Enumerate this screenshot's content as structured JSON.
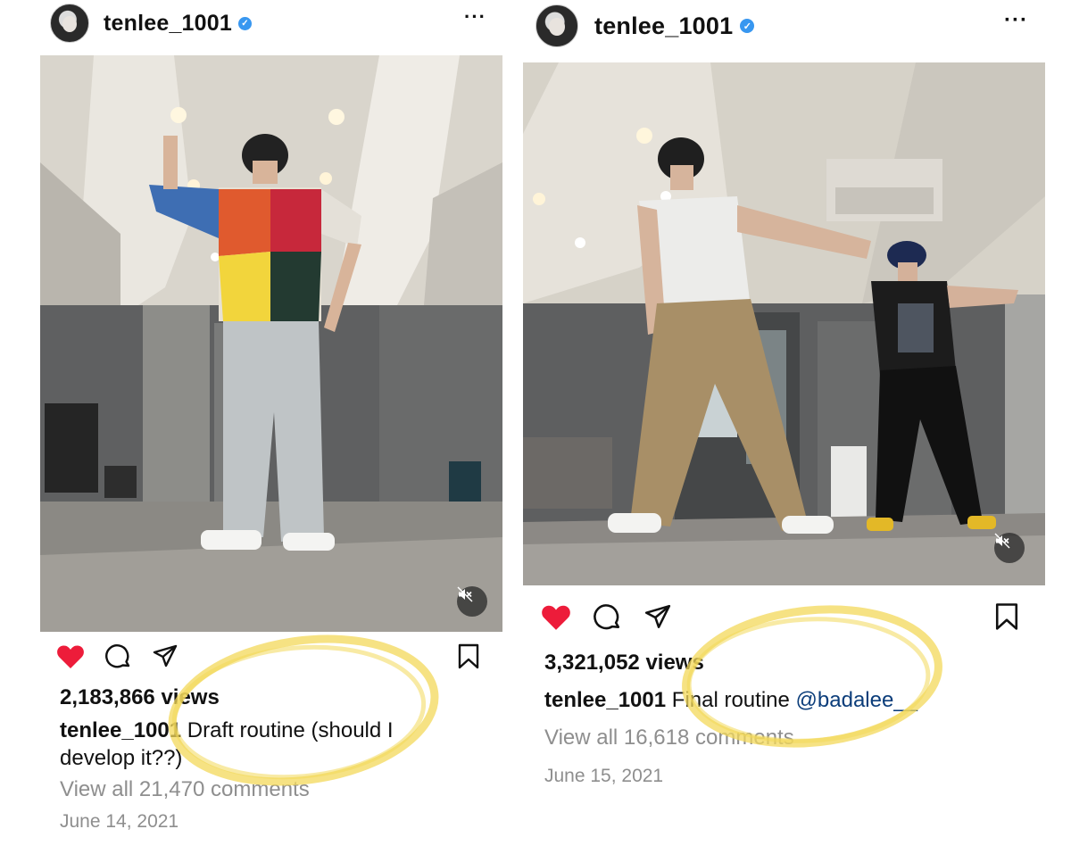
{
  "left_post": {
    "username": "tenlee_1001",
    "views": "2,183,866 views",
    "caption_user": "tenlee_1001",
    "caption_text": "Draft routine (should I develop it??)",
    "comments": "View all 21,470 comments",
    "date": "June 14, 2021",
    "liked": true
  },
  "right_post": {
    "username": "tenlee_1001",
    "views": "3,321,052 views",
    "caption_user": "tenlee_1001",
    "caption_text": "Final routine",
    "mention": "@badalee__",
    "comments": "View all 16,618 comments",
    "date": "June 15, 2021",
    "liked": true
  },
  "icons": {
    "verified": "verified-badge-icon",
    "more": "more-options-icon",
    "like": "heart-icon",
    "comment": "comment-icon",
    "share": "share-icon",
    "save": "bookmark-icon",
    "mute": "muted-speaker-icon"
  },
  "colors": {
    "heart": "#ed1c3a",
    "verified": "#3897f0",
    "mention": "#0b3d7a",
    "secondary_text": "#8e8e8e",
    "highlight": "#f3d85a"
  }
}
